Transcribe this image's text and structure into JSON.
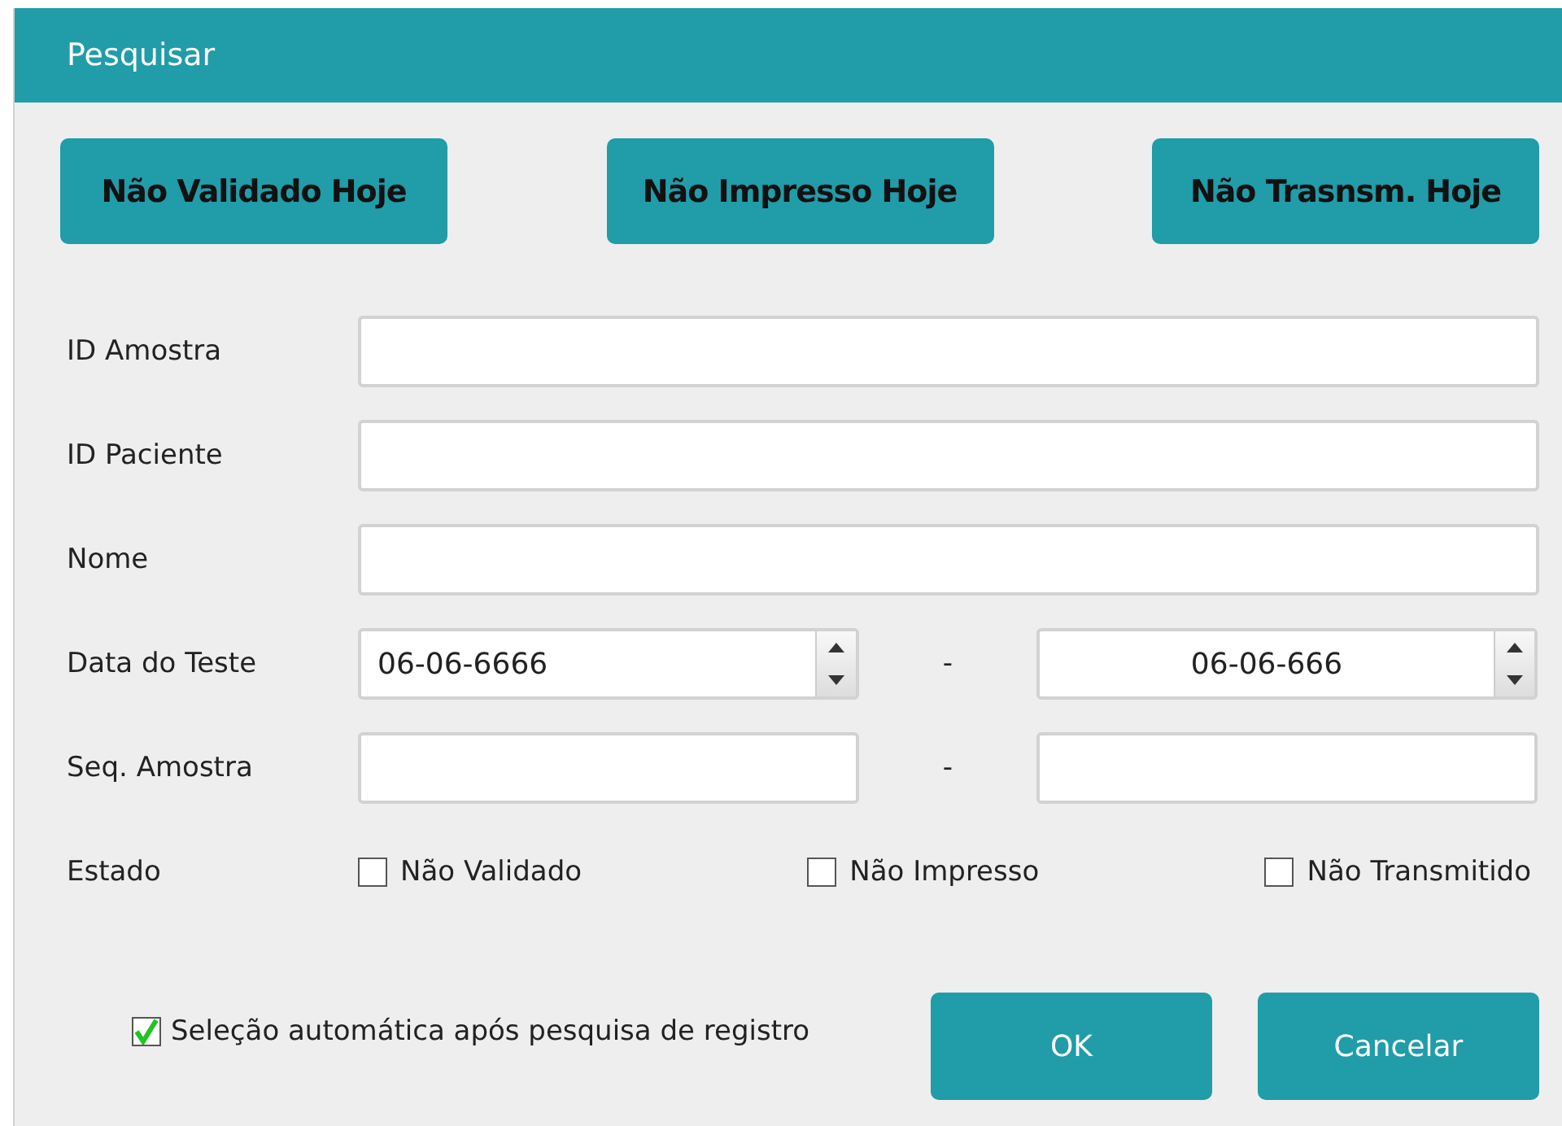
{
  "window": {
    "title": "Pesquisar"
  },
  "quick_buttons": [
    "Não Validado Hoje",
    "Não Impresso Hoje",
    "Não Trasnsm. Hoje"
  ],
  "fields": [
    {
      "kind": "text",
      "label": "ID Amostra"
    },
    {
      "kind": "text",
      "label": "ID Paciente"
    },
    {
      "kind": "text",
      "label": "Nome"
    },
    {
      "kind": "date_range",
      "label": "Data do Teste",
      "from": "06-06-6666",
      "separator": "-",
      "to": "06-06-666"
    },
    {
      "kind": "range",
      "label": "Seq. Amostra",
      "separator": "-"
    },
    {
      "kind": "checks",
      "label": "Estado",
      "options": [
        {
          "label": "Não Validado",
          "checked": false
        },
        {
          "label": "Não Impresso",
          "checked": false
        },
        {
          "label": "Não Transmitido",
          "checked": false
        }
      ]
    }
  ],
  "auto_select": {
    "label": "Seleção automática após pesquisa de registro",
    "checked": true
  },
  "buttons": [
    "OK",
    "Cancelar"
  ]
}
